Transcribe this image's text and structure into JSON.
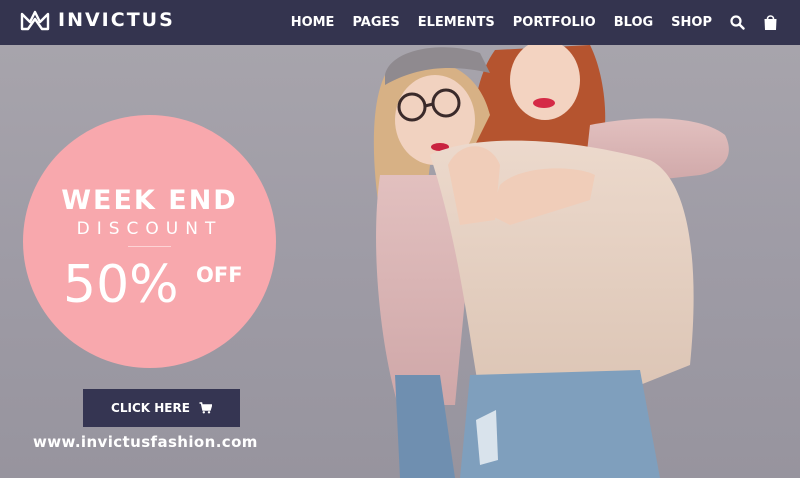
{
  "brand": {
    "name": "INVICTUS",
    "logo_icon": "crown-mountain-logo"
  },
  "nav": {
    "items": [
      {
        "label": "HOME"
      },
      {
        "label": "PAGES"
      },
      {
        "label": "ELEMENTS"
      },
      {
        "label": "PORTFOLIO"
      },
      {
        "label": "BLOG"
      },
      {
        "label": "SHOP"
      }
    ],
    "search_icon": "search-icon",
    "cart_icon": "shopping-bag-icon"
  },
  "promo": {
    "line1": "WEEK END",
    "line2": "DISCOUNT",
    "percent": "50%",
    "off": "OFF"
  },
  "cta": {
    "label": "CLICK HERE",
    "icon": "cart-icon"
  },
  "website": "www.invictusfashion.com",
  "colors": {
    "navbar": "#34344f",
    "accent_pink": "#f8a8ad",
    "button": "#353552",
    "background": "#9f9ca6"
  }
}
